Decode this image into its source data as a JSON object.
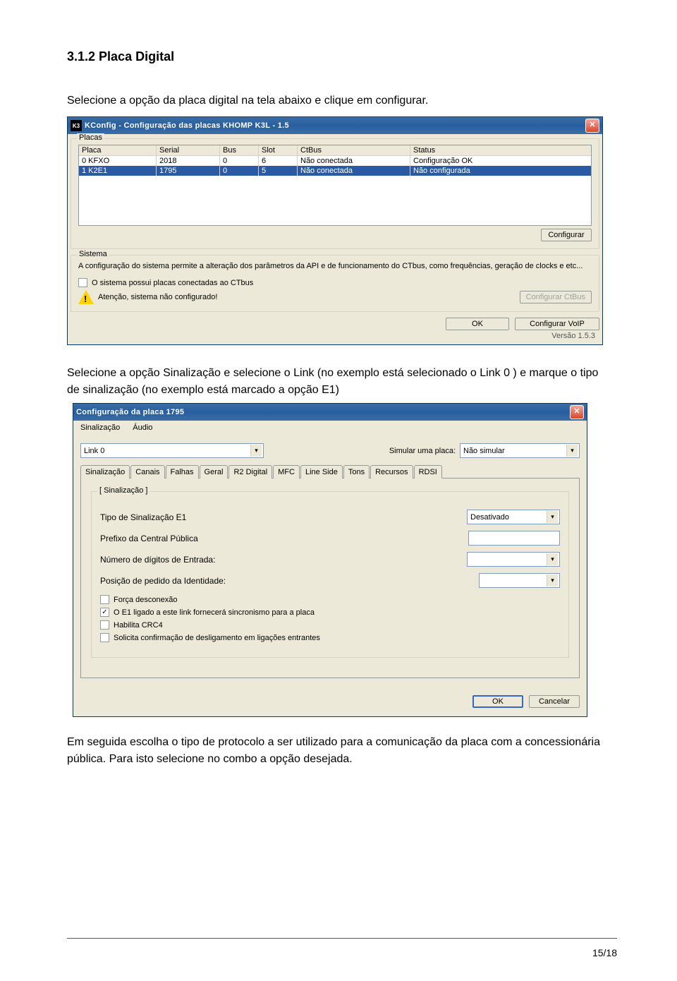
{
  "doc": {
    "heading": "3.1.2 Placa Digital",
    "intro": "Selecione a opção da placa digital na tela abaixo e clique em configurar.",
    "mid_text": "Selecione a opção Sinalização e selecione o Link (no exemplo está selecionado o Link 0 ) e marque  o tipo de sinalização (no exemplo está marcado a opção E1)",
    "end_text": "Em seguida escolha o tipo de protocolo a ser utilizado para a comunicação da placa com a concessionária pública. Para isto selecione no combo a opção desejada.",
    "page_num": "15/18"
  },
  "win1": {
    "app_icon": "K3",
    "title": "KConfig - Configuração das placas KHOMP K3L - 1.5",
    "placas_legend": "Placas",
    "headers": {
      "placa": "Placa",
      "serial": "Serial",
      "bus": "Bus",
      "slot": "Slot",
      "ctbus": "CtBus",
      "status": "Status"
    },
    "rows": [
      {
        "placa": "0 KFXO",
        "serial": "2018",
        "bus": "0",
        "slot": "6",
        "ctbus": "Não conectada",
        "status": "Configuração OK",
        "selected": false
      },
      {
        "placa": "1 K2E1",
        "serial": "1795",
        "bus": "0",
        "slot": "5",
        "ctbus": "Não conectada",
        "status": "Não configurada",
        "selected": true
      }
    ],
    "btn_configurar": "Configurar",
    "sistema_legend": "Sistema",
    "sistema_desc": "A configuração do sistema permite a alteração dos parâmetros da API e de funcionamento do CTbus, como frequências, geração de clocks e etc...",
    "chk_ctbus": "O sistema possui placas conectadas ao CTbus",
    "warn_text": "Atenção, sistema não configurado!",
    "btn_cfg_ctbus": "Configurar CtBus",
    "btn_ok": "OK",
    "btn_cfg_voip": "Configurar VoIP",
    "version": "Versão 1.5.3"
  },
  "win2": {
    "title": "Configuração da placa 1795",
    "menu": {
      "sinalizacao": "Sinalização",
      "audio": "Áudio"
    },
    "link_label": "Link 0",
    "sim_label": "Simular uma placa:",
    "sim_value": "Não simular",
    "tabs": [
      "Sinalização",
      "Canais",
      "Falhas",
      "Geral",
      "R2 Digital",
      "MFC",
      "Line Side",
      "Tons",
      "Recursos",
      "RDSI"
    ],
    "sig_legend": "[ Sinalização ]",
    "f_tipo": "Tipo de Sinalização E1",
    "f_tipo_val": "Desativado",
    "f_prefixo": "Prefixo da Central Pública",
    "f_numdig": "Número de dígitos de Entrada:",
    "f_pos": "Posição de pedido da Identidade:",
    "chk1": "Força desconexão",
    "chk2": "O E1 ligado a este link fornecerá sincronismo para a placa",
    "chk3": "Habilita CRC4",
    "chk4": "Solicita confirmação de desligamento em ligações entrantes",
    "btn_ok": "OK",
    "btn_cancel": "Cancelar"
  }
}
